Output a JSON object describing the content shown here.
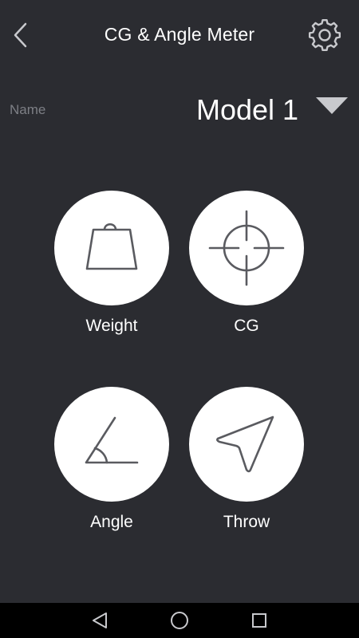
{
  "app_bar": {
    "title": "CG & Angle Meter",
    "back_icon": "chevron-left-icon",
    "settings_icon": "gear-icon"
  },
  "model": {
    "label": "Name",
    "value": "Model 1",
    "dropdown_icon": "triangle-down-icon"
  },
  "tools": [
    {
      "label": "Weight",
      "icon": "weight-scale-icon"
    },
    {
      "label": "CG",
      "icon": "crosshair-icon"
    },
    {
      "label": "Angle",
      "icon": "angle-icon"
    },
    {
      "label": "Throw",
      "icon": "paper-plane-icon"
    }
  ],
  "navigation": {
    "back": "nav-back-icon",
    "home": "nav-home-icon",
    "recents": "nav-recents-icon"
  },
  "colors": {
    "background": "#2b2c31",
    "circle": "#ffffff",
    "icon_stroke": "#5a5b60",
    "muted_text": "#7d7f85",
    "nav_bar": "#000000"
  }
}
